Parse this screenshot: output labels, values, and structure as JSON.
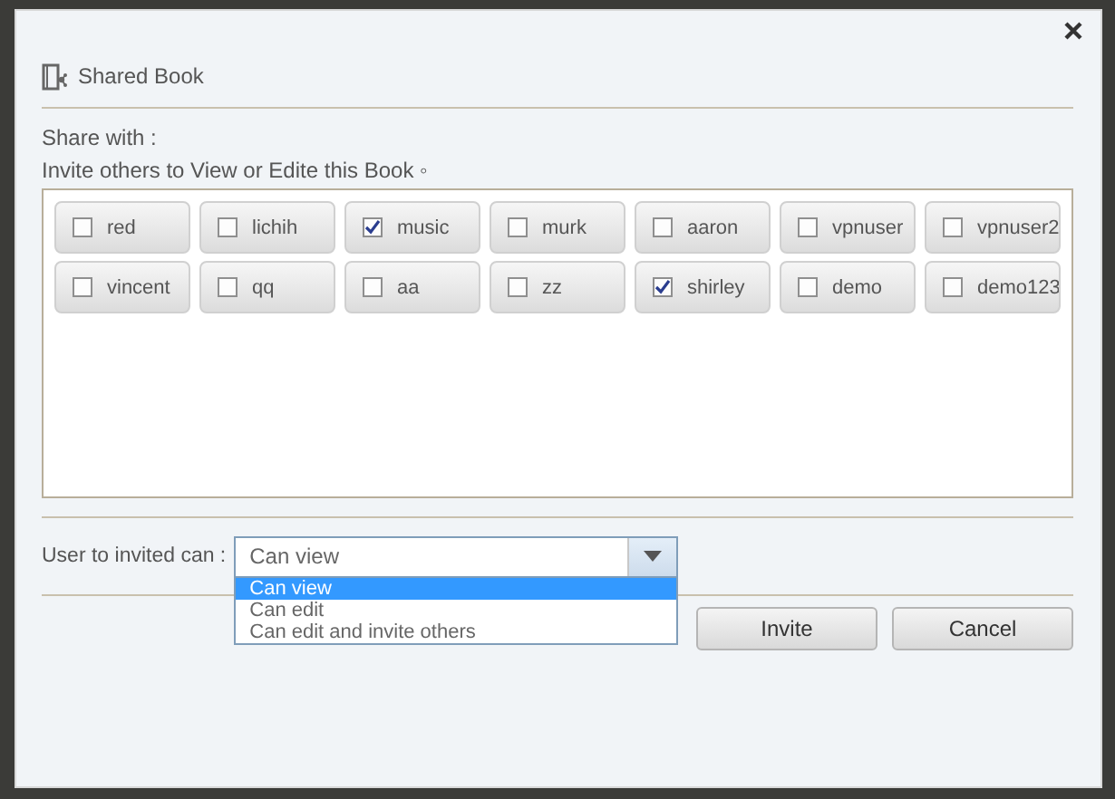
{
  "dialog": {
    "title": "Shared Book",
    "share_with": "Share with :",
    "hint": "Invite others to View or Edite this Book ◦",
    "users": [
      {
        "name": "red",
        "checked": false
      },
      {
        "name": "lichih",
        "checked": false
      },
      {
        "name": "music",
        "checked": true
      },
      {
        "name": "murk",
        "checked": false
      },
      {
        "name": "aaron",
        "checked": false
      },
      {
        "name": "vpnuser",
        "checked": false
      },
      {
        "name": "vpnuser2",
        "checked": false
      },
      {
        "name": "vincent",
        "checked": false
      },
      {
        "name": "qq",
        "checked": false
      },
      {
        "name": "aa",
        "checked": false
      },
      {
        "name": "zz",
        "checked": false
      },
      {
        "name": "shirley",
        "checked": true
      },
      {
        "name": "demo",
        "checked": false
      },
      {
        "name": "demo123",
        "checked": false
      }
    ],
    "permission": {
      "label": "User to invited can :",
      "value": "Can view",
      "expanded": true,
      "options": [
        {
          "label": "Can view",
          "selected": true
        },
        {
          "label": "Can edit",
          "selected": false
        },
        {
          "label": "Can edit and invite others",
          "selected": false
        }
      ]
    },
    "buttons": [
      "Invite",
      "Cancel"
    ]
  }
}
